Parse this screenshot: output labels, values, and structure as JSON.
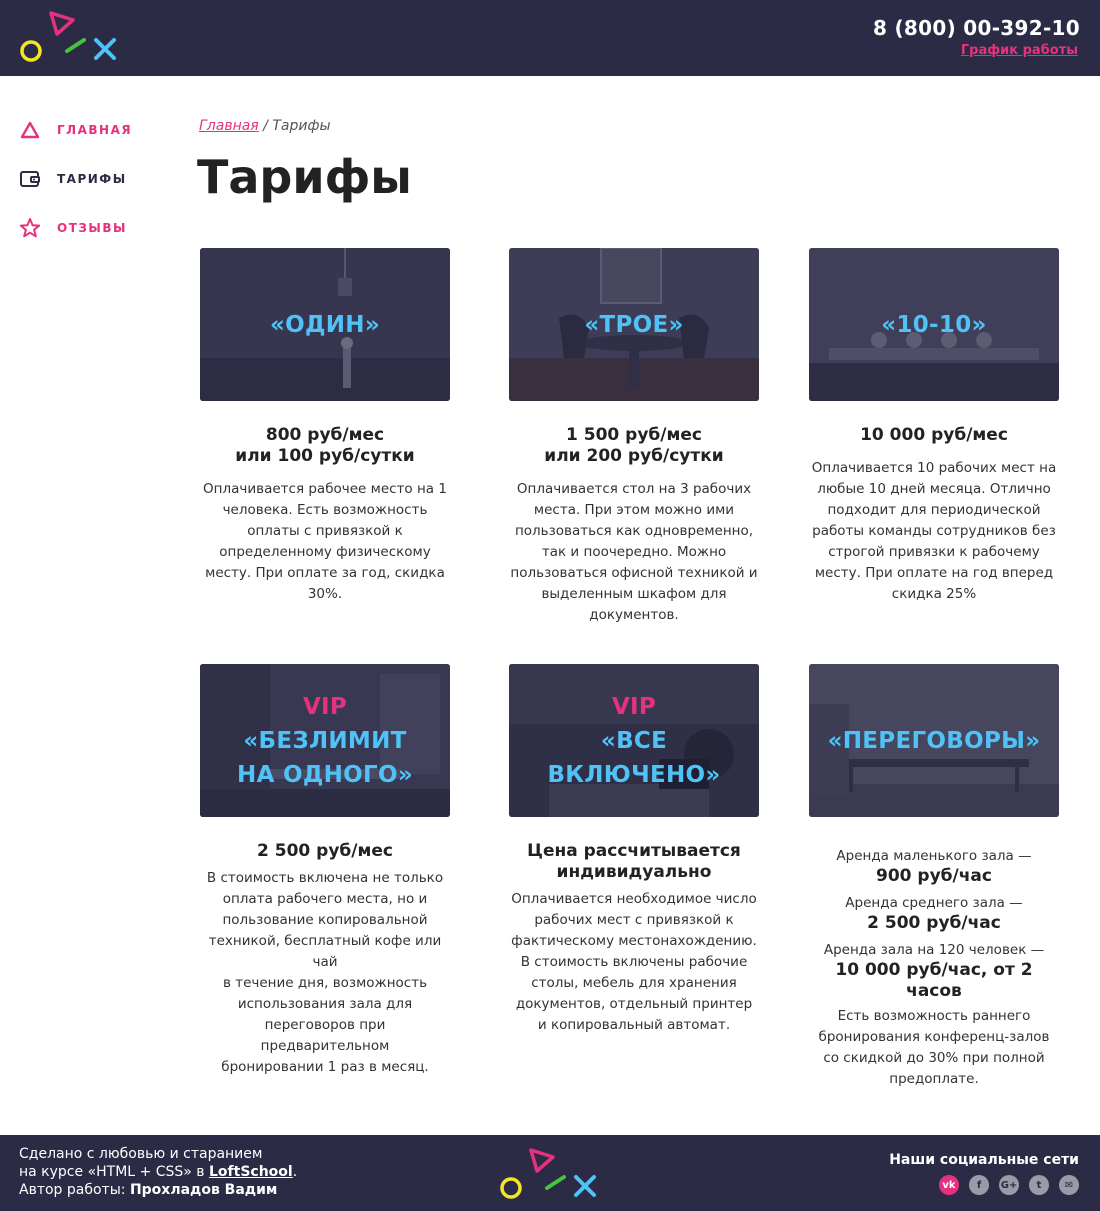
{
  "header": {
    "phone": "8 (800) 00-392-10",
    "schedule_link": "График работы"
  },
  "sidebar": {
    "items": [
      {
        "label": "ГЛАВНАЯ",
        "icon": "triangle-icon"
      },
      {
        "label": "ТАРИФЫ",
        "icon": "wallet-icon"
      },
      {
        "label": "ОТЗЫВЫ",
        "icon": "star-icon"
      }
    ]
  },
  "breadcrumb": {
    "home": "Главная",
    "separator": " / ",
    "current": "Тарифы"
  },
  "page_title": "Тарифы",
  "tariffs": [
    {
      "name": "«ОДИН»",
      "price": "800 руб/мес\nили 100 руб/сутки",
      "description": "Оплачивается рабочее место на 1\nчеловека. Есть возможность\nоплаты с привязкой к\nопределенному физическому\nместу. При оплате за год, скидка\n30%."
    },
    {
      "name": "«ТРОЕ»",
      "price": "1 500 руб/мес\nили 200 руб/сутки",
      "description": "Оплачивается стол на 3 рабочих\nместа. При этом можно ими\nпользоваться как одновременно,\nтак и поочередно. Можно\nпользоваться офисной техникой и\nвыделенным шкафом для\nдокументов."
    },
    {
      "name": "«10-10»",
      "price": "10 000 руб/мес",
      "description": "Оплачивается 10 рабочих мест на\nлюбые 10 дней месяца. Отлично\nподходит для периодической\nработы команды сотрудников без\nстрогой привязки к рабочему\nместу. При оплате на год вперед\nскидка 25%"
    },
    {
      "vip": "VIP",
      "name": "«БЕЗЛИМИТ\nНА ОДНОГО»",
      "price": "2 500 руб/мес",
      "description": "В стоимость включена не только\nоплата рабочего места, но и\nпользование копировальной\nтехникой, бесплатный кофе или чай\nв течение дня, возможность\nиспользования зала для\nпереговоров при предварительном\nбронировании 1 раз в месяц."
    },
    {
      "vip": "VIP",
      "name": "«ВСЕ\nВКЛЮЧЕНО»",
      "price": "Цена рассчитывается\nиндивидуально",
      "description": "Оплачивается необходимое число\nрабочих мест с привязкой к\nфактическому местонахождению.\nВ стоимость включены рабочие\nстолы, мебель для хранения\nдокументов, отдельный принтер\nи копировальный автомат."
    },
    {
      "name": "«ПЕРЕГОВОРЫ»",
      "halls": [
        {
          "label": "Аренда маленького зала —",
          "price": "900 руб/час"
        },
        {
          "label": "Аренда среднего зала —",
          "price": "2 500 руб/час"
        },
        {
          "label": "Аренда зала на 120 человек  —",
          "price": "10 000 руб/час, от 2 часов"
        }
      ],
      "description": "Есть возможность раннего\nбронирования конференц-залов\nсо скидкой до 30% при полной\nпредоплате."
    }
  ],
  "footer": {
    "line1": "Сделано с любовью и старанием",
    "line2_prefix": "на курсе «HTML + CSS» в ",
    "line2_link": "LoftSchool",
    "line2_suffix": ".",
    "line3_prefix": "Автор работы: ",
    "line3_author": "Прохладов Вадим",
    "social_title": "Наши социальные сети",
    "social": [
      {
        "icon": "vk-icon",
        "glyph": "vk"
      },
      {
        "icon": "facebook-icon",
        "glyph": "f"
      },
      {
        "icon": "google-plus-icon",
        "glyph": "G+"
      },
      {
        "icon": "twitter-icon",
        "glyph": "t"
      },
      {
        "icon": "mail-icon",
        "glyph": "✉"
      }
    ]
  },
  "colors": {
    "dark": "#2b2b45",
    "accent_pink": "#e6317f",
    "accent_blue": "#4fc3f7",
    "logo_yellow": "#f5e625",
    "logo_green": "#45c43c"
  }
}
